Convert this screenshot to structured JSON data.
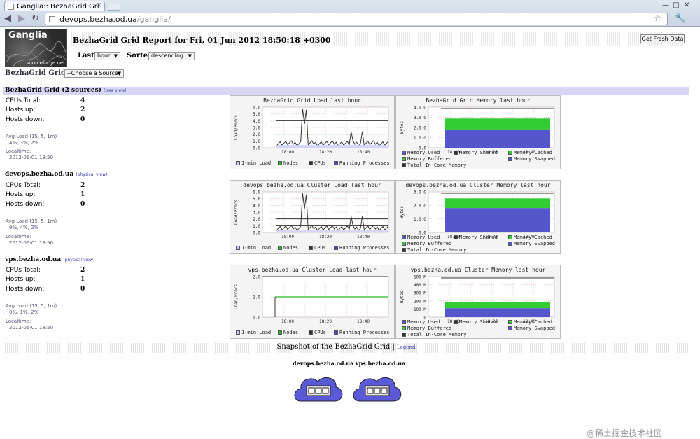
{
  "browser": {
    "tab_title": "Ganglia:: BezhaGrid Gri",
    "url_host": "devops.bezha.od.ua",
    "url_path": "/ganglia/"
  },
  "header": {
    "logo_text": "Ganglia",
    "logo_sub": "sourceforge.net",
    "title": "BezhaGrid Grid Report for Fri, 01 Jun 2012 18:50:18 +0300",
    "fresh_button": "Get Fresh Data",
    "last_label": "Last",
    "last_value": "hour",
    "sorted_label": "Sorted",
    "sorted_value": "descending",
    "breadcrumb": "BezhaGrid Grid >",
    "source_select": "--Choose a Source"
  },
  "sections": [
    {
      "title": "BezhaGrid Grid (2 sources)",
      "view_link": "(tree view)",
      "cpus_label": "CPUs Total:",
      "cpus": "4",
      "up_label": "Hosts up:",
      "up": "2",
      "down_label": "Hosts down:",
      "down": "0",
      "avg_label": "Avg Load (15, 5, 1m)",
      "avg": "4%, 3%, 2%",
      "time_label": "Localtime:",
      "time": "2012-06-01 18:50",
      "load_title": "BezhaGrid Grid Load last hour",
      "mem_title": "BezhaGrid Grid Memory last hour",
      "load_y": [
        "6.0",
        "5.0",
        "4.0",
        "3.0",
        "2.0",
        "1.0",
        "0.0"
      ],
      "mem_y": [
        "4.0 G",
        "3.0 G",
        "2.0 G",
        "1.0 G",
        "0.0"
      ]
    },
    {
      "title": "devops.bezha.od.ua",
      "view_link": "(physical view)",
      "cpus_label": "CPUs Total:",
      "cpus": "2",
      "up_label": "Hosts up:",
      "up": "1",
      "down_label": "Hosts down:",
      "down": "0",
      "avg_label": "Avg Load (15, 5, 1m)",
      "avg": "9%, 4%, 2%",
      "time_label": "Localtime:",
      "time": "2012-06-01 18:50",
      "load_title": "devops.bezha.od.ua Cluster Load last hour",
      "mem_title": "devops.bezha.od.ua Cluster Memory last hour",
      "load_y": [
        "6.0",
        "5.0",
        "4.0",
        "3.0",
        "2.0",
        "1.0",
        "0.0"
      ],
      "mem_y": [
        "3.0 G",
        "2.0 G",
        "1.0 G",
        "0.0"
      ]
    },
    {
      "title": "vps.bezha.od.ua",
      "view_link": "(physical view)",
      "cpus_label": "CPUs Total:",
      "cpus": "2",
      "up_label": "Hosts up:",
      "up": "1",
      "down_label": "Hosts down:",
      "down": "0",
      "avg_label": "Avg Load (15, 5, 1m)",
      "avg": "0%, 1%, 2%",
      "time_label": "Localtime:",
      "time": "2012-06-01 18:50",
      "load_title": "vps.bezha.od.ua Cluster Load last hour",
      "mem_title": "vps.bezha.od.ua Cluster Memory last hour",
      "load_y": [
        "2.0",
        "1.0",
        "0.0"
      ],
      "mem_y": [
        "500 M",
        "400 M",
        "300 M",
        "200 M",
        "100 M",
        "0"
      ]
    }
  ],
  "graph_common": {
    "load_ylabel": "Load/Procs",
    "mem_ylabel": "Bytes",
    "x_ticks": [
      "18:00",
      "18:20",
      "18:40"
    ],
    "load_legend": [
      "1-min Load",
      "Nodes",
      "CPUs",
      "Running Processes"
    ],
    "mem_legend": [
      "Memory Used",
      "Memory Shared",
      "Memory Cached",
      "Memory Buffered",
      "Memory Swapped",
      "Total In-Core Memory"
    ],
    "colors": {
      "load1": "#ccccff",
      "nodes": "#22bb22",
      "cpus": "#333333",
      "running": "#4444cc",
      "mem_used": "#5555cc",
      "mem_shared": "#333333",
      "mem_cached": "#33cc33",
      "mem_buffered": "#44bb44",
      "mem_swapped": "#5555cc",
      "total": "#333333"
    }
  },
  "snapshot": {
    "title": "Snapshot of the BezhaGrid Grid |",
    "legend_link": "Legend",
    "nodes": [
      "devops.bezha.od.ua",
      "vps.bezha.od.ua"
    ]
  },
  "watermark": "@稀土掘金技术社区"
}
